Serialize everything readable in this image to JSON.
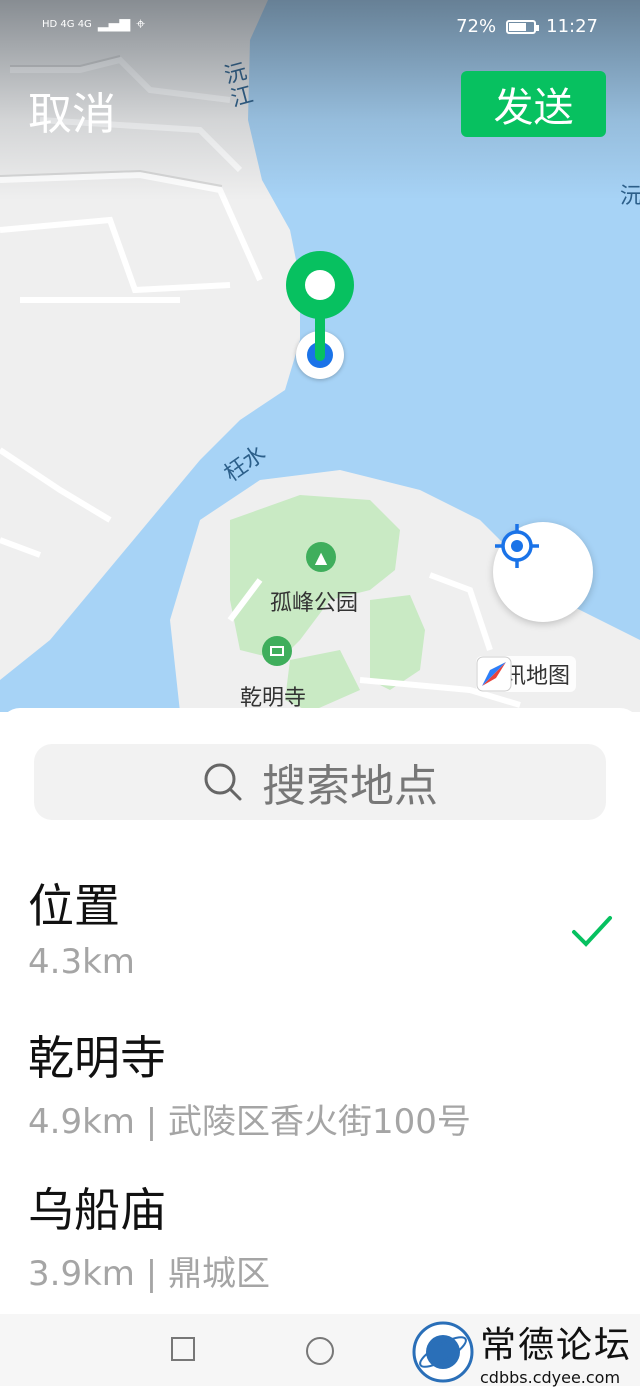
{
  "status_bar": {
    "signal_left": "HD 4G 4G",
    "battery_percent": "72%",
    "time": "11:27",
    "battery_level": 0.72
  },
  "header": {
    "cancel_label": "取消",
    "send_label": "发送"
  },
  "map": {
    "labels": {
      "river_1": "沅江",
      "river_2": "沅",
      "river_3": "枉水",
      "park": "孤峰公园",
      "temple": "乾明寺"
    },
    "provider": "腾讯地图",
    "colors": {
      "water": "#a7d3f6",
      "land": "#efefef",
      "park": "#c9eac4",
      "pin": "#07c160",
      "dot": "#1a73e8"
    }
  },
  "search": {
    "placeholder": "搜索地点"
  },
  "places": [
    {
      "name": "位置",
      "detail": "4.3km",
      "selected": true
    },
    {
      "name": "乾明寺",
      "detail": "4.9km | 武陵区香火街100号",
      "selected": false
    },
    {
      "name": "乌船庙",
      "detail": "3.9km | 鼎城区",
      "selected": false
    }
  ],
  "watermark": {
    "title": "常德论坛",
    "url": "cdbbs.cdyee.com"
  },
  "accent_color": "#07c160"
}
